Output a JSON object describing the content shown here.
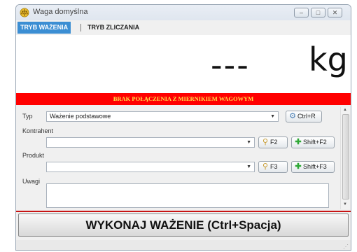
{
  "window": {
    "title": "Waga domyślna",
    "minimize_glyph": "–",
    "maximize_glyph": "□",
    "close_glyph": "✕",
    "app_icon": "scale-icon"
  },
  "tabs": [
    {
      "label": "TRYB WAŻENIA",
      "active": true
    },
    {
      "label": "TRYB ZLICZANIA",
      "active": false
    }
  ],
  "display": {
    "weight": "---",
    "unit": "kg"
  },
  "alert": {
    "text": "BRAK POŁĄCZENIA Z MIERNIKIEM WAGOWYM",
    "bg": "#ff0000",
    "fg": "#ffe34a"
  },
  "form": {
    "typ": {
      "label": "Typ",
      "value": "Ważenie podstawowe",
      "button": "Ctrl+R"
    },
    "kontrahent": {
      "label": "Kontrahent",
      "value": "",
      "search_button": "F2",
      "add_button": "Shift+F2"
    },
    "produkt": {
      "label": "Produkt",
      "value": "",
      "search_button": "F3",
      "add_button": "Shift+F3"
    },
    "uwagi": {
      "label": "Uwagi",
      "value": ""
    }
  },
  "action": {
    "label": "WYKONAJ WAŻENIE (Ctrl+Spacja)"
  },
  "colors": {
    "accent_tab": "#3b8ed3",
    "separator_red": "#c81414"
  }
}
